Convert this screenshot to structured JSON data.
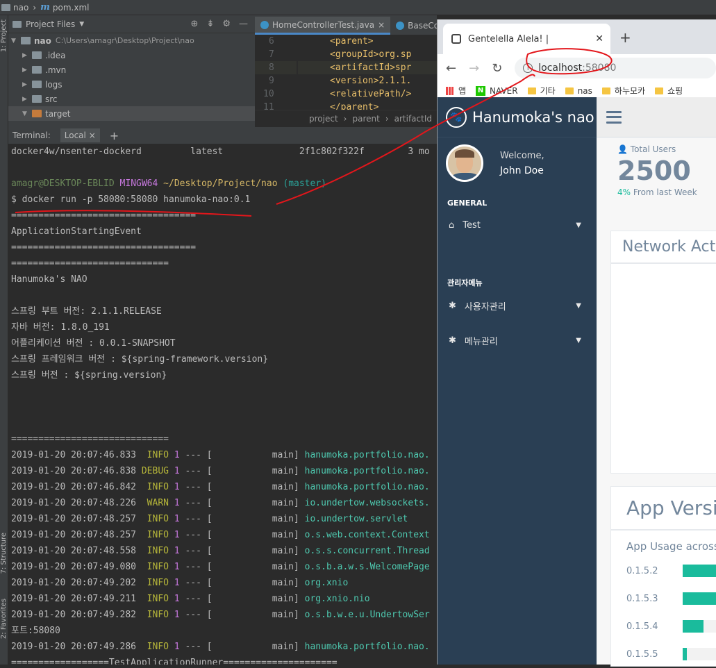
{
  "ide": {
    "project_name": "nao",
    "pom_file": "pom.xml",
    "side_tabs": {
      "project": "1: Project",
      "structure": "7: Structure",
      "favorites": "2: Favorites"
    },
    "project_panel": {
      "title": "Project Files",
      "tree": [
        {
          "label": "nao",
          "path": "C:\\Users\\amagr\\Desktop\\Project\\nao",
          "expanded": true
        },
        {
          "label": ".idea"
        },
        {
          "label": ".mvn"
        },
        {
          "label": "logs"
        },
        {
          "label": "src"
        },
        {
          "label": "target",
          "expanded": true
        }
      ]
    },
    "editor": {
      "tabs": [
        {
          "label": "HomeControllerTest.java"
        },
        {
          "label": "BaseConfi"
        }
      ],
      "line_numbers": [
        "6",
        "7",
        "8",
        "9",
        "10",
        "11"
      ],
      "lines": [
        "<parent>",
        "    <groupId>org.sp",
        "    <artifactId>spr",
        "    <version>2.1.1.",
        "    <relativePath/>",
        "</parent>"
      ],
      "breadcrumb": [
        "project",
        "parent",
        "artifactId"
      ]
    },
    "terminal": {
      "tab_label": "Terminal:",
      "session": "Local",
      "add": "+",
      "image_line": {
        "name": "docker4w/nsenter-dockerd",
        "tag": "latest",
        "id": "2f1c802f322f",
        "created": "3 mo"
      },
      "prompt": {
        "user": "amagr@DESKTOP-EBLID",
        "shell": "MINGW64",
        "dir": "~/Desktop/Project/nao",
        "branch": "(master)"
      },
      "command": "$ docker run -p 58080:58080 hanumoka-nao:0.1",
      "banner": [
        "==================================",
        "ApplicationStartingEvent",
        "==================================",
        "=============================",
        "Hanumoka's NAO",
        "",
        "스프링 부트 버전: 2.1.1.RELEASE",
        "자바 버전: 1.8.0_191",
        "어플리케이션 버전 : 0.0.1-SNAPSHOT",
        "스프링 프레임워크 버전 : ${spring-framework.version}",
        "스프링 버전 : ${spring.version}",
        "",
        "",
        "",
        "============================="
      ],
      "logs": [
        {
          "ts": "2019-01-20 20:07:46.833",
          "level": " INFO",
          "pid": "1",
          "thread": "main",
          "logger": "hanumoka.portfolio.nao."
        },
        {
          "ts": "2019-01-20 20:07:46.838",
          "level": "DEBUG",
          "pid": "1",
          "thread": "main",
          "logger": "hanumoka.portfolio.nao."
        },
        {
          "ts": "2019-01-20 20:07:46.842",
          "level": " INFO",
          "pid": "1",
          "thread": "main",
          "logger": "hanumoka.portfolio.nao."
        },
        {
          "ts": "2019-01-20 20:07:48.226",
          "level": " WARN",
          "pid": "1",
          "thread": "main",
          "logger": "io.undertow.websockets."
        },
        {
          "ts": "2019-01-20 20:07:48.257",
          "level": " INFO",
          "pid": "1",
          "thread": "main",
          "logger": "io.undertow.servlet"
        },
        {
          "ts": "2019-01-20 20:07:48.257",
          "level": " INFO",
          "pid": "1",
          "thread": "main",
          "logger": "o.s.web.context.Context"
        },
        {
          "ts": "2019-01-20 20:07:48.558",
          "level": " INFO",
          "pid": "1",
          "thread": "main",
          "logger": "o.s.s.concurrent.Thread"
        },
        {
          "ts": "2019-01-20 20:07:49.080",
          "level": " INFO",
          "pid": "1",
          "thread": "main",
          "logger": "o.s.b.a.w.s.WelcomePage"
        },
        {
          "ts": "2019-01-20 20:07:49.202",
          "level": " INFO",
          "pid": "1",
          "thread": "main",
          "logger": "org.xnio"
        },
        {
          "ts": "2019-01-20 20:07:49.211",
          "level": " INFO",
          "pid": "1",
          "thread": "main",
          "logger": "org.xnio.nio"
        },
        {
          "ts": "2019-01-20 20:07:49.282",
          "level": " INFO",
          "pid": "1",
          "thread": "main",
          "logger": "o.s.b.w.e.u.UndertowSer"
        }
      ],
      "port_line": "포트:58080",
      "last_log": {
        "ts": "2019-01-20 20:07:49.286",
        "level": " INFO",
        "pid": "1",
        "thread": "main",
        "logger": "hanumoka.portfolio.nao."
      },
      "runner_line": "==================TestApplicationRunner====================="
    }
  },
  "browser": {
    "tab_title": "Gentelella Alela! |",
    "url_host": "localhost",
    "url_port": ":58080",
    "bookmarks": [
      "앱",
      "NAVER",
      "기타",
      "nas",
      "하누모카",
      "쇼핑"
    ],
    "app": {
      "brand": "Hanumoka's nao",
      "welcome": "Welcome,",
      "user": "John Doe",
      "section_general": "GENERAL",
      "menu_test": "Test",
      "section_admin": "관리자메뉴",
      "menu_users": "사용자관리",
      "menu_menus": "메뉴관리",
      "stat_label": "Total Users",
      "stat_value": "2500",
      "stat_delta_pct": "4%",
      "stat_delta_text": "From last Week",
      "panel_network": "Network Activ",
      "panel_app": "App Versi",
      "app_usage": "App Usage across",
      "versions": [
        {
          "label": "0.1.5.2",
          "value": 0.9
        },
        {
          "label": "0.1.5.3",
          "value": 0.9
        },
        {
          "label": "0.1.5.4",
          "value": 0.55
        },
        {
          "label": "0.1.5.5",
          "value": 0.1
        }
      ]
    }
  },
  "colors": {
    "annotation": "#e3161b",
    "sidebar": "#2a3f54",
    "accent": "#1abb9c"
  }
}
